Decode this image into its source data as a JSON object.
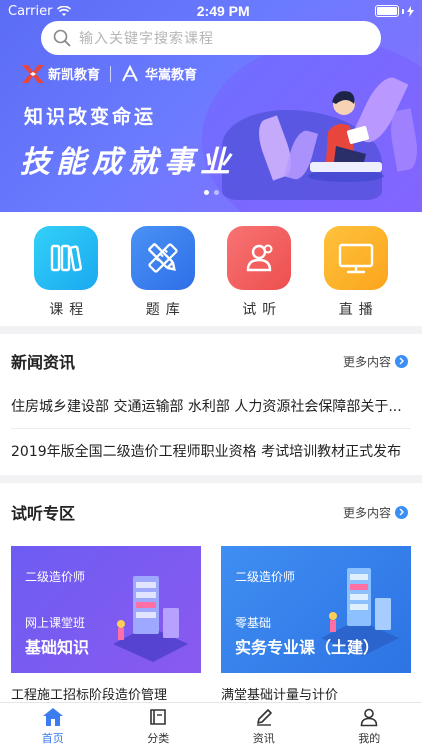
{
  "status_bar": {
    "carrier": "Carrier",
    "time": "2:49 PM"
  },
  "search": {
    "placeholder": "输入关键字搜索课程"
  },
  "banner": {
    "brand1": "新凯教育",
    "brand2": "华嵩教育",
    "slogan1": "知识改变命运",
    "slogan2": "技能成就事业"
  },
  "categories": [
    {
      "label": "课程",
      "icon": "books-icon",
      "color": "#2bc6f5"
    },
    {
      "label": "题库",
      "icon": "pencil-ruler-icon",
      "color": "#3a82f2"
    },
    {
      "label": "试听",
      "icon": "users-icon",
      "color": "#f25a5a"
    },
    {
      "label": "直播",
      "icon": "monitor-icon",
      "color": "#fdb02a"
    }
  ],
  "news": {
    "title": "新闻资讯",
    "more": "更多内容",
    "items": [
      "住房城乡建设部 交通运输部 水利部 人力资源社会保障部关于...",
      "2019年版全国二级造价工程师职业资格 考试培训教材正式发布"
    ]
  },
  "trial": {
    "title": "试听专区",
    "more": "更多内容",
    "cards": [
      {
        "sub1": "二级造价师",
        "sub2": "网上课堂班",
        "main": "基础知识",
        "title": "工程施工招标阶段造价管理"
      },
      {
        "sub1": "二级造价师",
        "sub2": "零基础",
        "main": "实务专业课（土建）",
        "title": "满堂基础计量与计价"
      }
    ]
  },
  "tabs": [
    {
      "label": "首页",
      "icon": "home-icon"
    },
    {
      "label": "分类",
      "icon": "book-icon"
    },
    {
      "label": "资讯",
      "icon": "edit-icon"
    },
    {
      "label": "我的",
      "icon": "profile-icon"
    }
  ],
  "colors": {
    "accent": "#3b7cf0",
    "banner": "#5b6cf5"
  }
}
